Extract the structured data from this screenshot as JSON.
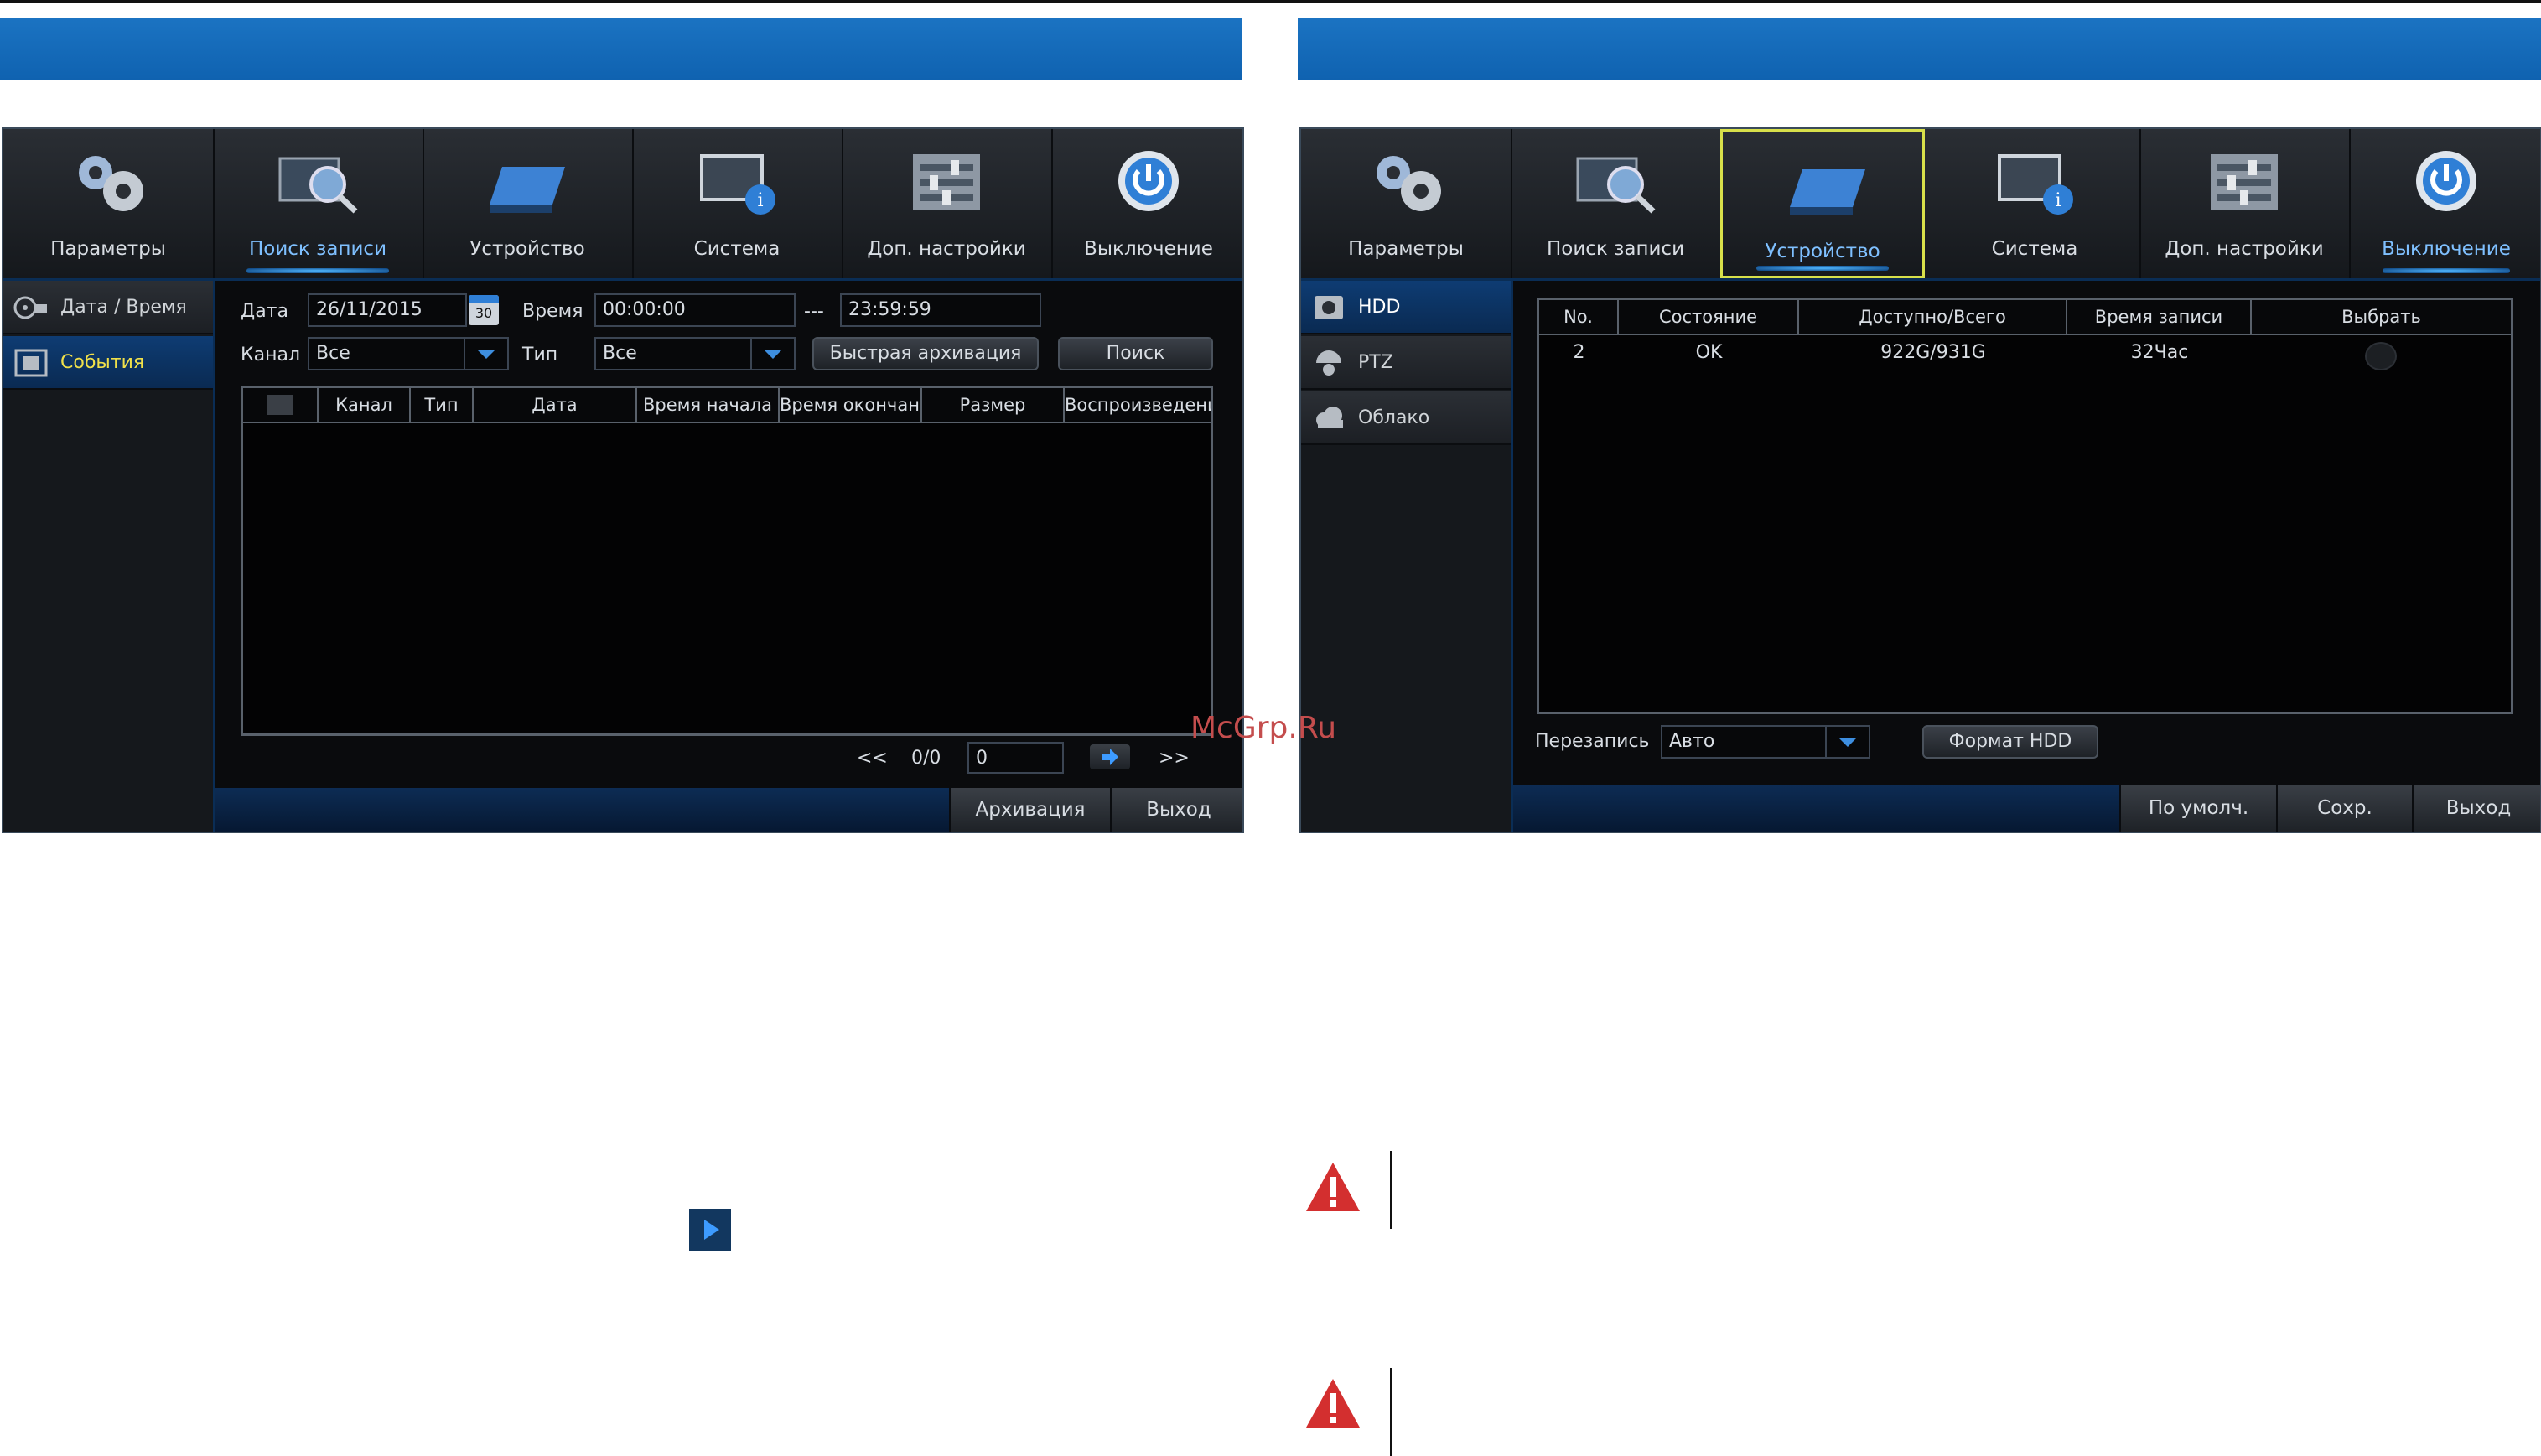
{
  "left_screen": {
    "menu": [
      {
        "label": "Параметры",
        "icon": "gears-icon"
      },
      {
        "label": "Поиск записи",
        "icon": "search-record-icon"
      },
      {
        "label": "Устройство",
        "icon": "hdd-device-icon"
      },
      {
        "label": "Система",
        "icon": "system-info-icon"
      },
      {
        "label": "Доп. настройки",
        "icon": "sliders-icon"
      },
      {
        "label": "Выключение",
        "icon": "power-icon"
      }
    ],
    "active_menu": "Поиск записи",
    "sidebar": [
      {
        "label": "Дата / Время",
        "icon": "film-reel-icon"
      },
      {
        "label": "События",
        "icon": "film-frame-icon"
      }
    ],
    "form": {
      "date_label": "Дата",
      "date_value": "26/11/2015",
      "calendar_day": "30",
      "time_label": "Время",
      "time_from": "00:00:00",
      "time_sep": "---",
      "time_to": "23:59:59",
      "channel_label": "Канал",
      "channel_value": "Все",
      "type_label": "Тип",
      "type_value": "Все",
      "quick_backup": "Быстрая архивация",
      "search": "Поиск"
    },
    "table_headers": [
      "",
      "Канал",
      "Тип",
      "Дата",
      "Время начала",
      "Время окончания",
      "Размер",
      "Воспроизведение"
    ],
    "pager": {
      "prev": "<<",
      "counter": "0/0",
      "page_value": "0",
      "next": ">>"
    },
    "bottom": {
      "backup": "Архивация",
      "exit": "Выход"
    }
  },
  "right_screen": {
    "menu": [
      {
        "label": "Параметры",
        "icon": "gears-icon"
      },
      {
        "label": "Поиск записи",
        "icon": "search-record-icon"
      },
      {
        "label": "Устройство",
        "icon": "hdd-device-icon"
      },
      {
        "label": "Система",
        "icon": "system-info-icon"
      },
      {
        "label": "Доп. настройки",
        "icon": "sliders-icon"
      },
      {
        "label": "Выключение",
        "icon": "power-icon"
      }
    ],
    "active_menu": "Устройство",
    "sidebar": [
      {
        "label": "HDD",
        "icon": "hdd-icon"
      },
      {
        "label": "PTZ",
        "icon": "ptz-camera-icon"
      },
      {
        "label": "Облако",
        "icon": "cloud-icon"
      }
    ],
    "table_headers": [
      "No.",
      "Состояние",
      "Доступно/Всего",
      "Время записи",
      "Выбрать"
    ],
    "rows": [
      {
        "no": "2",
        "state": "OK",
        "space": "922G/931G",
        "rec_time": "32Час"
      }
    ],
    "overwrite_label": "Перезапись",
    "overwrite_value": "Авто",
    "format_hdd": "Формат HDD",
    "bottom": {
      "default": "По умолч.",
      "save": "Сохр.",
      "exit": "Выход"
    }
  },
  "watermark": "McGrp.Ru",
  "colors": {
    "banner": "#1b73c2",
    "active_tab": "#7fc0ff",
    "selected_side": "#f0e04a",
    "warning": "#d32f2f"
  }
}
